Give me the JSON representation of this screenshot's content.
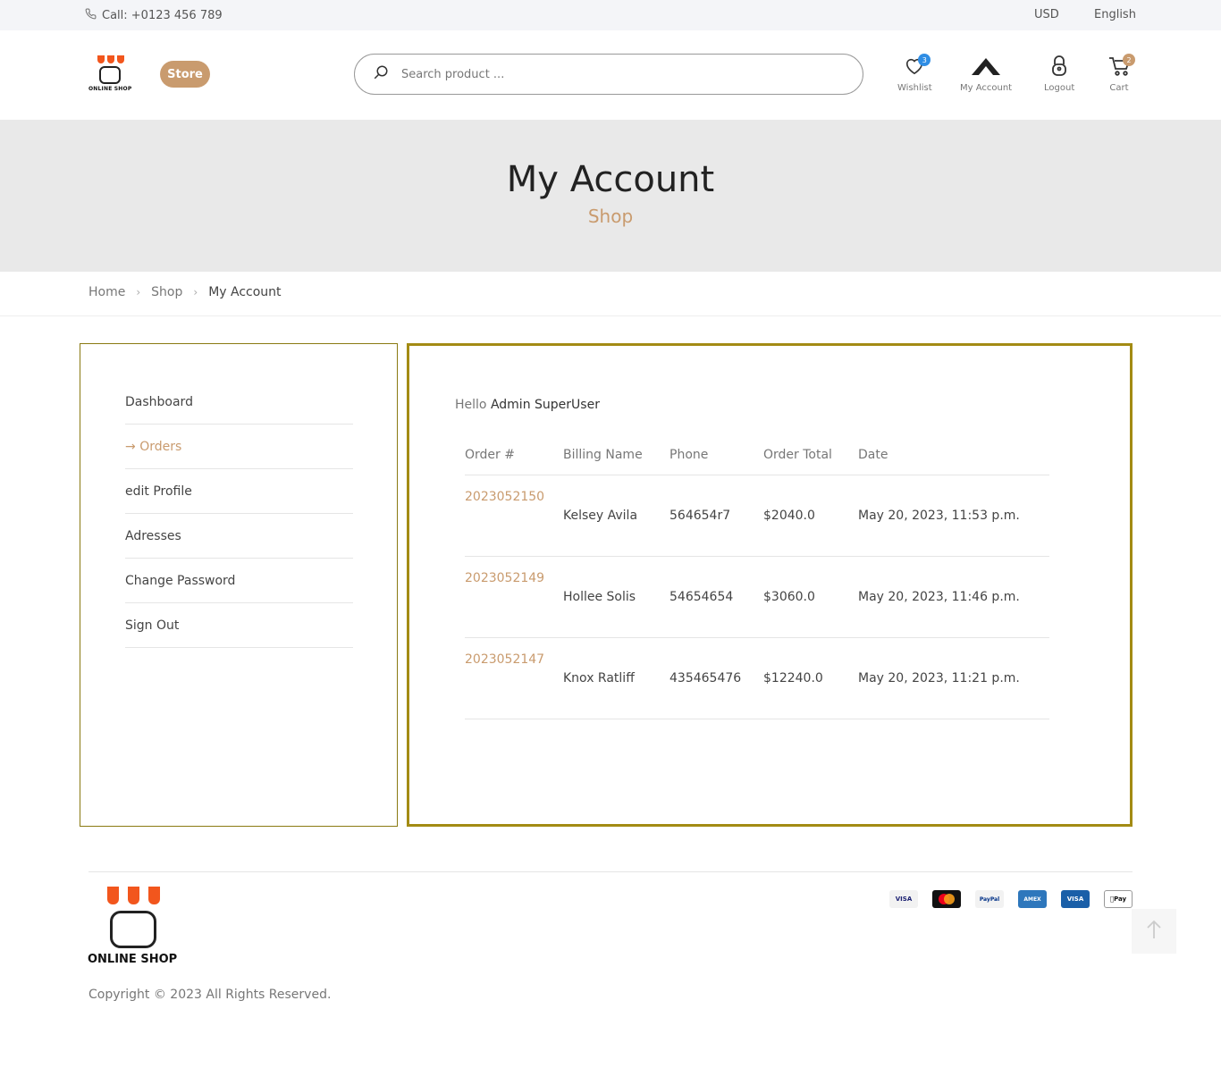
{
  "topbar": {
    "call": "Call: +0123 456 789",
    "currency": "USD",
    "language": "English"
  },
  "header": {
    "logo_text": "ONLINE SHOP",
    "store_label": "Store",
    "search_placeholder": "Search product ...",
    "wishlist": {
      "label": "Wishlist",
      "count": "3"
    },
    "account_label": "My Account",
    "logout_label": "Logout",
    "cart": {
      "label": "Cart",
      "count": "2"
    }
  },
  "banner": {
    "title": "My Account",
    "subtitle": "Shop"
  },
  "breadcrumb": [
    "Home",
    "Shop",
    "My Account"
  ],
  "sidebar": {
    "items": [
      {
        "label": "Dashboard",
        "active": false
      },
      {
        "label": "Orders",
        "active": true
      },
      {
        "label": "edit Profile",
        "active": false
      },
      {
        "label": "Adresses",
        "active": false
      },
      {
        "label": "Change Password",
        "active": false
      },
      {
        "label": "Sign Out",
        "active": false
      }
    ]
  },
  "content": {
    "greeting": "Hello",
    "user_name": "Admin SuperUser",
    "columns": [
      "Order #",
      "Billing Name",
      "Phone",
      "Order Total",
      "Date"
    ],
    "orders": [
      {
        "number": "2023052150",
        "name": "Kelsey Avila",
        "phone": "564654r7",
        "total": "$2040.0",
        "date": "May 20, 2023, 11:53 p.m."
      },
      {
        "number": "2023052149",
        "name": "Hollee Solis",
        "phone": "54654654",
        "total": "$3060.0",
        "date": "May 20, 2023, 11:46 p.m."
      },
      {
        "number": "2023052147",
        "name": "Knox Ratliff",
        "phone": "435465476",
        "total": "$12240.0",
        "date": "May 20, 2023, 11:21 p.m."
      }
    ]
  },
  "footer": {
    "logo_text": "ONLINE SHOP",
    "copyright": "Copyright © 2023 All Rights Reserved.",
    "payments": [
      {
        "label": "VISA",
        "icon": "visa-icon"
      },
      {
        "label": "",
        "icon": "mastercard-icon"
      },
      {
        "label": "PayPal",
        "icon": "paypal-icon"
      },
      {
        "label": "AMEX",
        "icon": "amex-icon"
      },
      {
        "label": "VISA",
        "icon": "visa-electron-icon"
      },
      {
        "label": "Pay",
        "icon": "apple-pay-icon"
      }
    ]
  },
  "colors": {
    "accent": "#c99b6e",
    "border": "#a38b14",
    "logo_orange": "#f2561d",
    "wishlist_badge": "#2f8de4"
  }
}
